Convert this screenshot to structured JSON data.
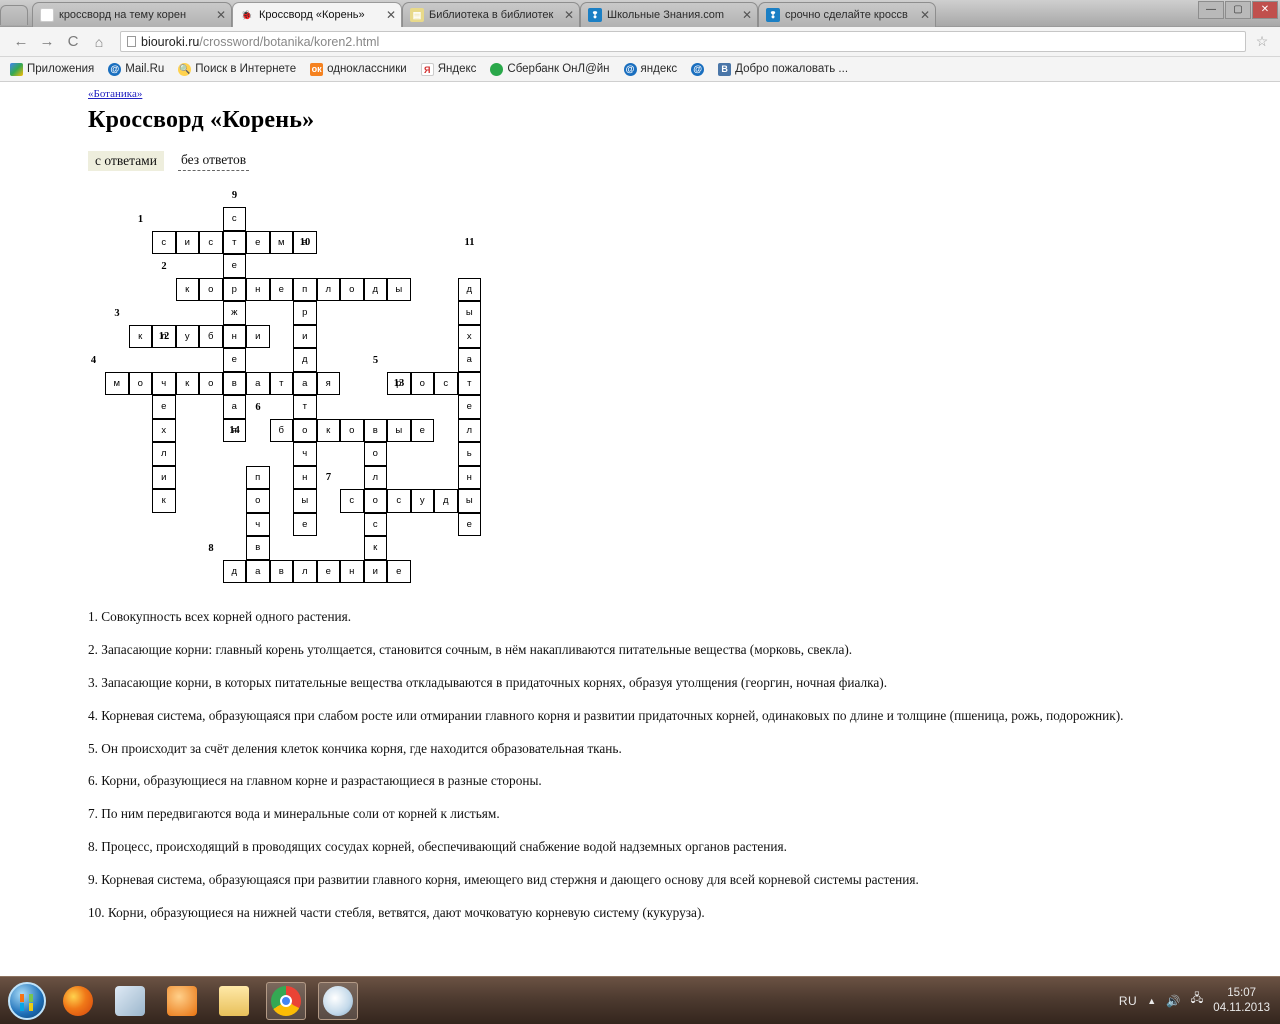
{
  "browser": {
    "tabs": [
      {
        "label": "кроссворд на тему корен",
        "favicon": "yandex-icon",
        "active": false
      },
      {
        "label": "Кроссворд «Корень»",
        "favicon": "ladybug-icon",
        "active": true
      },
      {
        "label": "Библиотека в библиотек",
        "favicon": "book-icon",
        "active": false
      },
      {
        "label": "Школьные Знания.com",
        "favicon": "znania-icon",
        "active": false
      },
      {
        "label": "срочно сделайте кроссв",
        "favicon": "znania-icon",
        "active": false
      }
    ],
    "close_label": "✕",
    "nav": {
      "back": "←",
      "forward": "→",
      "reload": "C",
      "home": "⌂",
      "url_host": "biouroki.ru",
      "url_path": "/crossword/botanika/koren2.html",
      "star": "☆"
    },
    "bookmarks": [
      {
        "label": "Приложения",
        "icon": "apps-grid-icon"
      },
      {
        "label": "Mail.Ru",
        "icon": "mailru-icon"
      },
      {
        "label": "Поиск в Интернете",
        "icon": "search-icon"
      },
      {
        "label": "одноклассники",
        "icon": "odnoklassniki-icon"
      },
      {
        "label": "Яндекс",
        "icon": "yandex-icon"
      },
      {
        "label": "Сбербанк ОнЛ@йн",
        "icon": "sberbank-icon"
      },
      {
        "label": "яндекс",
        "icon": "yandex-round-icon"
      },
      {
        "label": "",
        "icon": "yandex-round-icon"
      },
      {
        "label": "Добро пожаловать ...",
        "icon": "vk-icon"
      }
    ],
    "window_controls": {
      "minimize": "—",
      "maximize": "▢",
      "close": "✕"
    }
  },
  "page": {
    "breadcrumb": "«Ботаника»",
    "title": "Кроссворд «Корень»",
    "tabs": {
      "with_answers": "с ответами",
      "without_answers": "без ответов"
    }
  },
  "crossword": {
    "numbers": [
      {
        "n": "9",
        "col": 5,
        "row": 0
      },
      {
        "n": "1",
        "col": 1,
        "row": 1
      },
      {
        "n": "10",
        "col": 8,
        "row": 2
      },
      {
        "n": "11",
        "col": 15,
        "row": 2
      },
      {
        "n": "2",
        "col": 2,
        "row": 3
      },
      {
        "n": "3",
        "col": 0,
        "row": 5
      },
      {
        "n": "12",
        "col": 2,
        "row": 6
      },
      {
        "n": "4",
        "col": -1,
        "row": 7
      },
      {
        "n": "5",
        "col": 11,
        "row": 7
      },
      {
        "n": "13",
        "col": 12,
        "row": 8
      },
      {
        "n": "6",
        "col": 6,
        "row": 9
      },
      {
        "n": "14",
        "col": 5,
        "row": 10
      },
      {
        "n": "7",
        "col": 9,
        "row": 12
      },
      {
        "n": "8",
        "col": 4,
        "row": 15
      }
    ],
    "cells": [
      {
        "l": "с",
        "col": 5,
        "row": 1
      },
      {
        "l": "с",
        "col": 2,
        "row": 2
      },
      {
        "l": "и",
        "col": 3,
        "row": 2
      },
      {
        "l": "с",
        "col": 4,
        "row": 2
      },
      {
        "l": "т",
        "col": 5,
        "row": 2
      },
      {
        "l": "е",
        "col": 6,
        "row": 2
      },
      {
        "l": "м",
        "col": 7,
        "row": 2
      },
      {
        "l": "а",
        "col": 8,
        "row": 2
      },
      {
        "l": "е",
        "col": 5,
        "row": 3
      },
      {
        "l": "к",
        "col": 3,
        "row": 4
      },
      {
        "l": "о",
        "col": 4,
        "row": 4
      },
      {
        "l": "р",
        "col": 5,
        "row": 4
      },
      {
        "l": "н",
        "col": 6,
        "row": 4
      },
      {
        "l": "е",
        "col": 7,
        "row": 4
      },
      {
        "l": "п",
        "col": 8,
        "row": 4
      },
      {
        "l": "л",
        "col": 9,
        "row": 4
      },
      {
        "l": "о",
        "col": 10,
        "row": 4
      },
      {
        "l": "д",
        "col": 11,
        "row": 4
      },
      {
        "l": "ы",
        "col": 12,
        "row": 4
      },
      {
        "l": "д",
        "col": 15,
        "row": 4
      },
      {
        "l": "ж",
        "col": 5,
        "row": 5
      },
      {
        "l": "р",
        "col": 8,
        "row": 5
      },
      {
        "l": "ы",
        "col": 15,
        "row": 5
      },
      {
        "l": "к",
        "col": 1,
        "row": 6
      },
      {
        "l": "л",
        "col": 2,
        "row": 6
      },
      {
        "l": "у",
        "col": 3,
        "row": 6
      },
      {
        "l": "б",
        "col": 4,
        "row": 6
      },
      {
        "l": "н",
        "col": 5,
        "row": 6
      },
      {
        "l": "и",
        "col": 6,
        "row": 6
      },
      {
        "l": "и",
        "col": 8,
        "row": 6
      },
      {
        "l": "х",
        "col": 15,
        "row": 6
      },
      {
        "l": "е",
        "col": 5,
        "row": 7
      },
      {
        "l": "д",
        "col": 8,
        "row": 7
      },
      {
        "l": "а",
        "col": 15,
        "row": 7
      },
      {
        "l": "м",
        "col": 0,
        "row": 8
      },
      {
        "l": "о",
        "col": 1,
        "row": 8
      },
      {
        "l": "ч",
        "col": 2,
        "row": 8
      },
      {
        "l": "к",
        "col": 3,
        "row": 8
      },
      {
        "l": "о",
        "col": 4,
        "row": 8
      },
      {
        "l": "в",
        "col": 5,
        "row": 8
      },
      {
        "l": "а",
        "col": 6,
        "row": 8
      },
      {
        "l": "т",
        "col": 7,
        "row": 8
      },
      {
        "l": "а",
        "col": 8,
        "row": 8
      },
      {
        "l": "я",
        "col": 9,
        "row": 8
      },
      {
        "l": "р",
        "col": 12,
        "row": 8
      },
      {
        "l": "о",
        "col": 13,
        "row": 8
      },
      {
        "l": "с",
        "col": 14,
        "row": 8
      },
      {
        "l": "т",
        "col": 15,
        "row": 8
      },
      {
        "l": "е",
        "col": 2,
        "row": 9
      },
      {
        "l": "а",
        "col": 5,
        "row": 9
      },
      {
        "l": "т",
        "col": 8,
        "row": 9
      },
      {
        "l": "е",
        "col": 15,
        "row": 9
      },
      {
        "l": "х",
        "col": 2,
        "row": 10
      },
      {
        "l": "я",
        "col": 5,
        "row": 10
      },
      {
        "l": "б",
        "col": 7,
        "row": 10
      },
      {
        "l": "о",
        "col": 8,
        "row": 10
      },
      {
        "l": "к",
        "col": 9,
        "row": 10
      },
      {
        "l": "о",
        "col": 10,
        "row": 10
      },
      {
        "l": "в",
        "col": 11,
        "row": 10
      },
      {
        "l": "ы",
        "col": 12,
        "row": 10
      },
      {
        "l": "е",
        "col": 13,
        "row": 10
      },
      {
        "l": "л",
        "col": 15,
        "row": 10
      },
      {
        "l": "л",
        "col": 2,
        "row": 11
      },
      {
        "l": "ч",
        "col": 8,
        "row": 11
      },
      {
        "l": "о",
        "col": 11,
        "row": 11
      },
      {
        "l": "ь",
        "col": 15,
        "row": 11
      },
      {
        "l": "и",
        "col": 2,
        "row": 12
      },
      {
        "l": "п",
        "col": 6,
        "row": 12
      },
      {
        "l": "н",
        "col": 8,
        "row": 12
      },
      {
        "l": "л",
        "col": 11,
        "row": 12
      },
      {
        "l": "н",
        "col": 15,
        "row": 12
      },
      {
        "l": "к",
        "col": 2,
        "row": 13
      },
      {
        "l": "о",
        "col": 6,
        "row": 13
      },
      {
        "l": "ы",
        "col": 8,
        "row": 13
      },
      {
        "l": "с",
        "col": 10,
        "row": 13
      },
      {
        "l": "о",
        "col": 11,
        "row": 13
      },
      {
        "l": "с",
        "col": 12,
        "row": 13
      },
      {
        "l": "у",
        "col": 13,
        "row": 13
      },
      {
        "l": "д",
        "col": 14,
        "row": 13
      },
      {
        "l": "ы",
        "col": 15,
        "row": 13
      },
      {
        "l": "ч",
        "col": 6,
        "row": 14
      },
      {
        "l": "е",
        "col": 8,
        "row": 14
      },
      {
        "l": "с",
        "col": 11,
        "row": 14
      },
      {
        "l": "е",
        "col": 15,
        "row": 14
      },
      {
        "l": "в",
        "col": 6,
        "row": 15
      },
      {
        "l": "к",
        "col": 11,
        "row": 15
      },
      {
        "l": "д",
        "col": 5,
        "row": 16
      },
      {
        "l": "а",
        "col": 6,
        "row": 16
      },
      {
        "l": "в",
        "col": 7,
        "row": 16
      },
      {
        "l": "л",
        "col": 8,
        "row": 16
      },
      {
        "l": "е",
        "col": 9,
        "row": 16
      },
      {
        "l": "н",
        "col": 10,
        "row": 16
      },
      {
        "l": "и",
        "col": 11,
        "row": 16
      },
      {
        "l": "е",
        "col": 12,
        "row": 16
      }
    ]
  },
  "clues": [
    "1. Совокупность всех корней одного растения.",
    "2. Запасающие корни: главный корень утолщается, становится сочным, в нём накапливаются питательные вещества (морковь, свекла).",
    "3. Запасающие корни, в которых питательные вещества откладываются в придаточных корнях, образуя утолщения (георгин, ночная фиалка).",
    "4. Корневая система, образующаяся при слабом росте или отмирании главного корня и развитии придаточных корней, одинаковых по длине и толщине (пшеница, рожь, подорожник).",
    "5. Он происходит за счёт деления клеток кончика корня, где находится образовательная ткань.",
    "6. Корни, образующиеся на главном корне и разрастающиеся в разные стороны.",
    "7. По ним передвигаются вода и минеральные соли от корней к листьям.",
    "8. Процесс, происходящий в проводящих сосудах корней, обеспечивающий снабжение водой надземных органов растения.",
    "9. Корневая система, образующаяся при развитии главного корня, имеющего вид стержня и дающего основу для всей корневой системы растения.",
    "10. Корни, образующиеся на нижней части стебля, ветвятся, дают мочковатую корневую систему (кукуруза)."
  ],
  "taskbar": {
    "start": "start-orb",
    "apps": [
      {
        "name": "firefox-icon"
      },
      {
        "name": "media-player-icon"
      },
      {
        "name": "video-player-icon"
      },
      {
        "name": "explorer-icon"
      },
      {
        "name": "chrome-icon"
      },
      {
        "name": "paint-icon"
      }
    ],
    "tray": {
      "language": "RU",
      "caret": "▲",
      "volume": "volume-icon",
      "network": "network-icon",
      "time": "15:07",
      "date": "04.11.2013"
    }
  }
}
